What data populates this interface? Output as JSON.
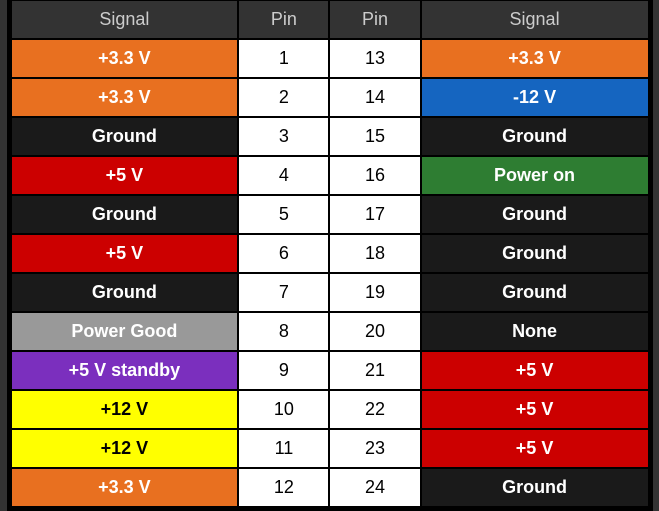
{
  "header": {
    "col1": "Signal",
    "col2": "Pin",
    "col3": "Pin",
    "col4": "Signal"
  },
  "rows": [
    {
      "left_signal": "+3.3 V",
      "left_class": "orange",
      "pin_left": "1",
      "pin_right": "13",
      "right_signal": "+3.3 V",
      "right_class": "orange"
    },
    {
      "left_signal": "+3.3 V",
      "left_class": "orange",
      "pin_left": "2",
      "pin_right": "14",
      "right_signal": "-12 V",
      "right_class": "blue"
    },
    {
      "left_signal": "Ground",
      "left_class": "black",
      "pin_left": "3",
      "pin_right": "15",
      "right_signal": "Ground",
      "right_class": "black"
    },
    {
      "left_signal": "+5 V",
      "left_class": "red",
      "pin_left": "4",
      "pin_right": "16",
      "right_signal": "Power on",
      "right_class": "green"
    },
    {
      "left_signal": "Ground",
      "left_class": "black",
      "pin_left": "5",
      "pin_right": "17",
      "right_signal": "Ground",
      "right_class": "black"
    },
    {
      "left_signal": "+5 V",
      "left_class": "red",
      "pin_left": "6",
      "pin_right": "18",
      "right_signal": "Ground",
      "right_class": "black"
    },
    {
      "left_signal": "Ground",
      "left_class": "black",
      "pin_left": "7",
      "pin_right": "19",
      "right_signal": "Ground",
      "right_class": "black"
    },
    {
      "left_signal": "Power Good",
      "left_class": "gray",
      "pin_left": "8",
      "pin_right": "20",
      "right_signal": "None",
      "right_class": "none-cell"
    },
    {
      "left_signal": "+5 V standby",
      "left_class": "purple",
      "pin_left": "9",
      "pin_right": "21",
      "right_signal": "+5 V",
      "right_class": "red"
    },
    {
      "left_signal": "+12 V",
      "left_class": "yellow",
      "pin_left": "10",
      "pin_right": "22",
      "right_signal": "+5 V",
      "right_class": "red"
    },
    {
      "left_signal": "+12 V",
      "left_class": "yellow",
      "pin_left": "11",
      "pin_right": "23",
      "right_signal": "+5 V",
      "right_class": "red"
    },
    {
      "left_signal": "+3.3 V",
      "left_class": "orange",
      "pin_left": "12",
      "pin_right": "24",
      "right_signal": "Ground",
      "right_class": "black"
    }
  ]
}
